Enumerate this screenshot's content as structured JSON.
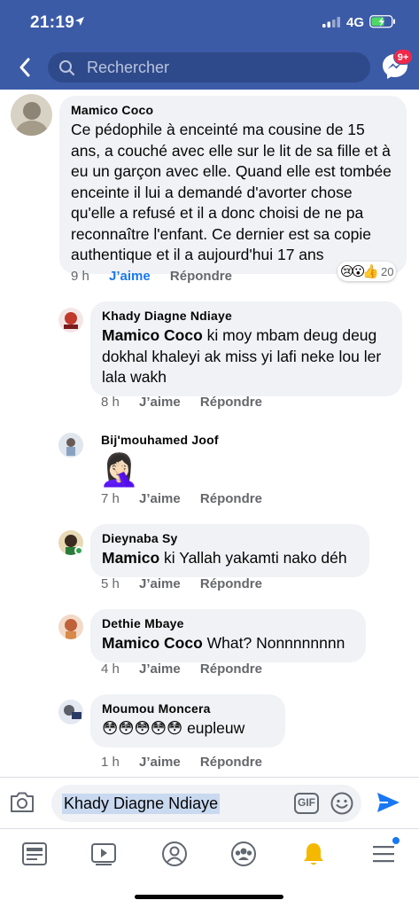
{
  "status_bar": {
    "time": "21:19",
    "network": "4G"
  },
  "header": {
    "search_placeholder": "Rechercher",
    "messenger_badge": "9+"
  },
  "actions": {
    "like": "J’aime",
    "reply": "Répondre"
  },
  "comments": [
    {
      "author": "Mamico Coco",
      "text": "Ce pédophile à enceinté ma cousine de 15 ans, a couché avec elle sur le lit de sa fille et à eu un garçon avec elle. Quand elle est tombée enceinte il lui a demandé d'avorter chose qu'elle a refusé et il a donc choisi de ne pa reconnaître l'enfant. Ce dernier est sa copie authentique et il a aujourd'hui 17 ans",
      "time": "9 h",
      "like_label": "J’aime",
      "reactions": {
        "emojis": [
          "😢",
          "😮",
          "👍"
        ],
        "count": "20"
      }
    },
    {
      "author": "Khady Diagne Ndiaye",
      "mention": "Mamico Coco",
      "text": " ki moy mbam deug deug dokhal khaleyi ak miss yi lafi neke lou ler lala wakh",
      "time": "8 h"
    },
    {
      "author": "Bij'mouhamed Joof",
      "emoji": "🤦🏻‍♀️",
      "time": "7 h"
    },
    {
      "author": "Dieynaba Sy",
      "mention": "Mamico",
      "text": " ki Yallah yakamti nako déh",
      "time": "5 h"
    },
    {
      "author": "Dethie Mbaye",
      "mention": "Mamico Coco",
      "text": " What? Nonnnnnnnn",
      "time": "4 h"
    },
    {
      "author": "Moumou Moncera",
      "text": "😳😳😳😳😳 eupleuw",
      "time": "1 h"
    }
  ],
  "composer": {
    "text": "Khady Diagne Ndiaye",
    "gif_label": "GIF"
  },
  "colors": {
    "brand": "#3b5ba7",
    "like_blue": "#1877f2",
    "bubble": "#f0f2f5"
  }
}
